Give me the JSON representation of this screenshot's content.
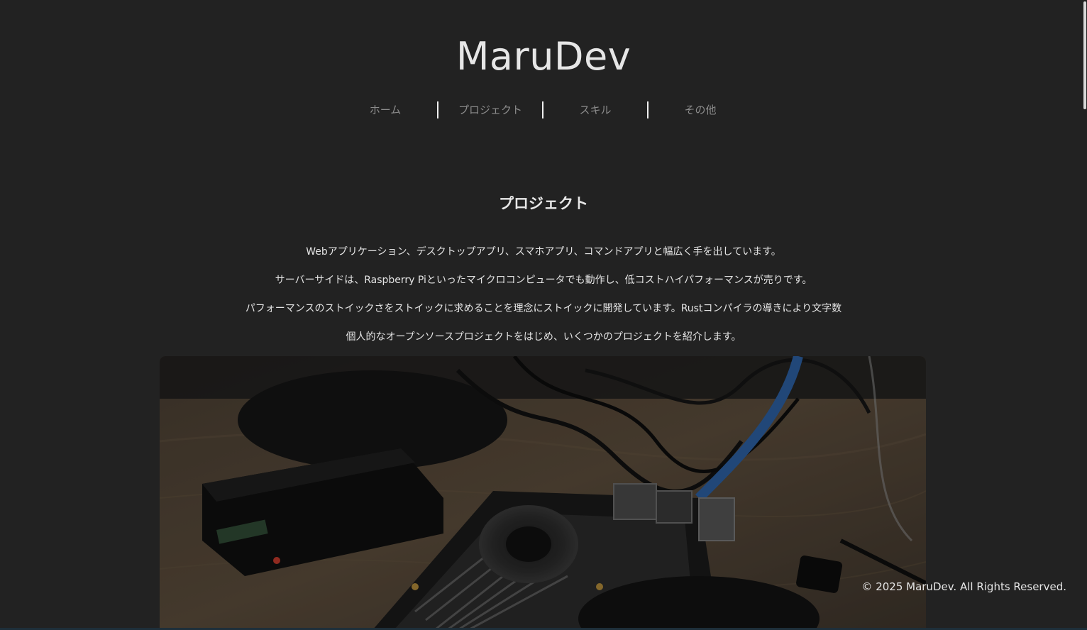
{
  "site": {
    "title": "MaruDev"
  },
  "nav": {
    "items": [
      {
        "label": "ホーム"
      },
      {
        "label": "プロジェクト"
      },
      {
        "label": "スキル"
      },
      {
        "label": "その他"
      }
    ]
  },
  "main": {
    "section_title": "プロジェクト",
    "intro_lines": [
      "Webアプリケーション、デスクトップアプリ、スマホアプリ、コマンドアプリと幅広く手を出しています。",
      "サーバーサイドは、Raspberry Piといったマイクロコンピュータでも動作し、低コストハイパフォーマンスが売りです。",
      "パフォーマンスのストイックさをストイックに求めることを理念にストイックに開発しています。Rustコンパイラの導きにより文字数",
      "個人的なオープンソースプロジェクトをはじめ、いくつかのプロジェクトを紹介します。"
    ],
    "hero_image": "raspberry-pi-photo"
  },
  "footer": {
    "copyright": "© 2025 MaruDev. All Rights Reserved."
  }
}
